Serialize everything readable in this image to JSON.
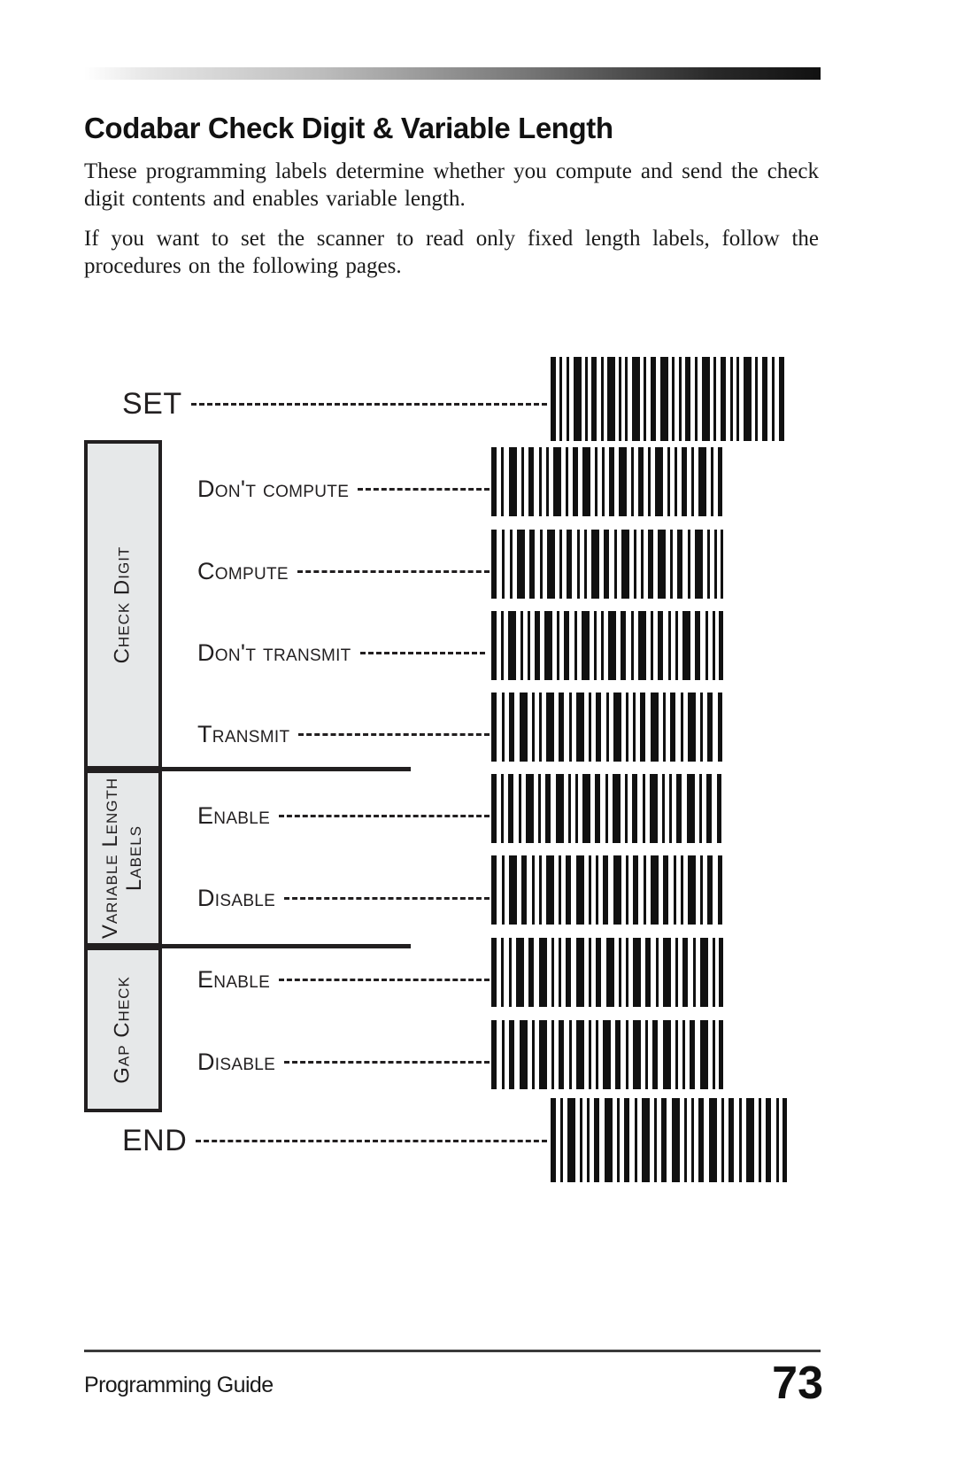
{
  "document": {
    "title": "Codabar Check Digit & Variable Length",
    "paragraphs": [
      "These programming labels determine whether you compute and send the check digit contents and enables variable length.",
      "If you want to set the scanner to read only fixed length labels, follow the procedures on the following pages."
    ]
  },
  "programming_sheet": {
    "start_label": "SET",
    "end_label": "END",
    "categories": [
      {
        "id": "check-digit",
        "label": "Check Digit"
      },
      {
        "id": "variable-length-labels",
        "label": "Variable Length\nLabels"
      },
      {
        "id": "gap-check",
        "label": "Gap Check"
      }
    ],
    "rows": [
      {
        "label": "Don't compute",
        "category": "check-digit"
      },
      {
        "label": "Compute",
        "category": "check-digit"
      },
      {
        "label": "Don't transmit",
        "category": "check-digit"
      },
      {
        "label": "Transmit",
        "category": "check-digit"
      },
      {
        "label": "Enable",
        "category": "variable-length-labels"
      },
      {
        "label": "Disable",
        "category": "variable-length-labels"
      },
      {
        "label": "Enable",
        "category": "gap-check"
      },
      {
        "label": "Disable",
        "category": "gap-check"
      }
    ]
  },
  "footer": {
    "left_text": "Programming Guide",
    "page_number": "73"
  },
  "colors": {
    "ink": "#221f20",
    "panel_fill": "#e6e8e9",
    "rule": "#3b3b3b"
  }
}
